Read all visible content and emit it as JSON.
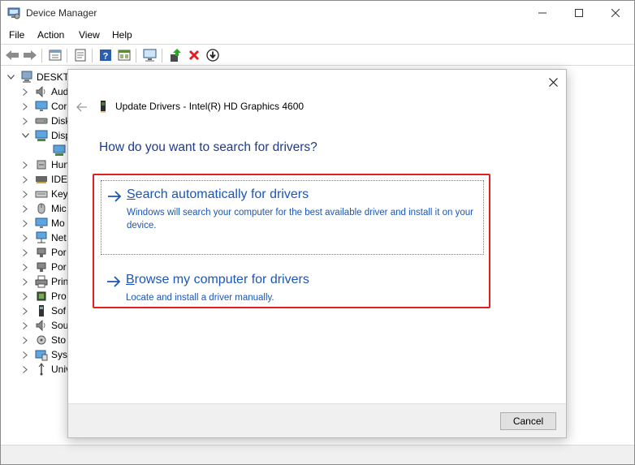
{
  "window": {
    "title": "Device Manager",
    "controls": [
      "minimize-icon",
      "maximize-icon",
      "close-icon"
    ]
  },
  "menu": [
    "File",
    "Action",
    "View",
    "Help"
  ],
  "toolbar": {
    "buttons": [
      "back-icon",
      "forward-icon",
      "properties-icon",
      "console-tree-icon",
      "help-icon",
      "show-hidden-icon",
      "scan-hardware-icon",
      "update-driver-icon",
      "uninstall-icon",
      "disable-icon"
    ]
  },
  "tree": {
    "root": "DESKTO",
    "items": [
      {
        "label": "Aud",
        "icon": "speaker-icon",
        "expanded": false
      },
      {
        "label": "Cor",
        "icon": "monitor-icon",
        "expanded": false
      },
      {
        "label": "Disk",
        "icon": "disk-icon",
        "expanded": false
      },
      {
        "label": "Disp",
        "icon": "display-adapter-icon",
        "expanded": true
      },
      {
        "label": "",
        "icon": "display-adapter-icon",
        "child": true
      },
      {
        "label": "Hun",
        "icon": "hid-icon",
        "expanded": false
      },
      {
        "label": "IDE",
        "icon": "ide-icon",
        "expanded": false
      },
      {
        "label": "Key",
        "icon": "keyboard-icon",
        "expanded": false
      },
      {
        "label": "Mic",
        "icon": "mouse-icon",
        "expanded": false
      },
      {
        "label": "Mo",
        "icon": "monitor-icon",
        "expanded": false
      },
      {
        "label": "Net",
        "icon": "network-icon",
        "expanded": false
      },
      {
        "label": "Por",
        "icon": "port-icon",
        "expanded": false
      },
      {
        "label": "Por",
        "icon": "port-icon",
        "expanded": false
      },
      {
        "label": "Prin",
        "icon": "printer-icon",
        "expanded": false
      },
      {
        "label": "Pro",
        "icon": "processor-icon",
        "expanded": false
      },
      {
        "label": "Sof",
        "icon": "software-device-icon",
        "expanded": false
      },
      {
        "label": "Sou",
        "icon": "speaker-icon",
        "expanded": false
      },
      {
        "label": "Sto",
        "icon": "storage-icon",
        "expanded": false
      },
      {
        "label": "Syst",
        "icon": "system-icon",
        "expanded": false
      },
      {
        "label": "Univ",
        "icon": "usb-icon",
        "expanded": false
      }
    ]
  },
  "dialog": {
    "title": "Update Drivers - Intel(R) HD Graphics 4600",
    "heading": "How do you want to search for drivers?",
    "options": [
      {
        "title": "Search automatically for drivers",
        "description": "Windows will search your computer for the best available driver and install it on your device."
      },
      {
        "title": "Browse my computer for drivers",
        "description": "Locate and install a driver manually."
      }
    ],
    "cancel_label": "Cancel"
  },
  "colors": {
    "link_blue": "#1a56b8",
    "heading_blue": "#1f3b8a",
    "highlight_red": "#e02020"
  }
}
